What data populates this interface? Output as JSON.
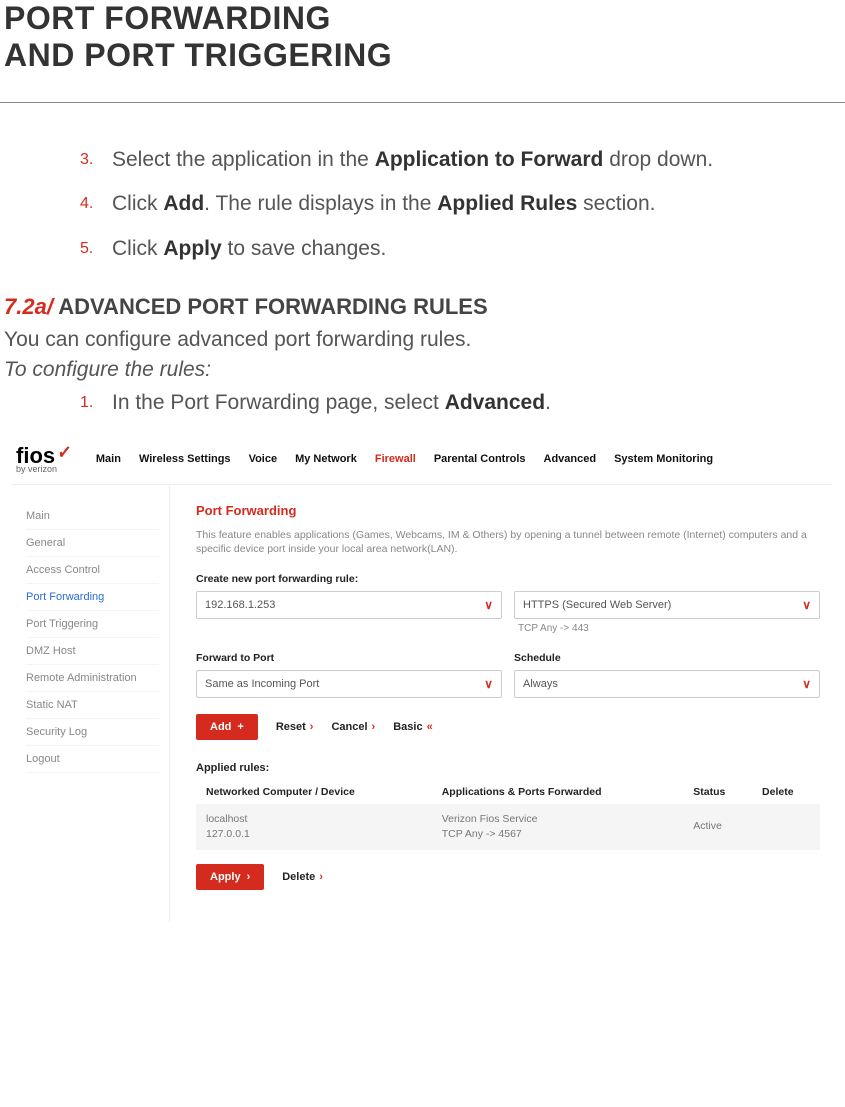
{
  "title_line1": "PORT FORWARDING",
  "title_line2": "AND PORT TRIGGERING",
  "steps_a": [
    {
      "num": "3.",
      "pre": "Select the application in the ",
      "b1": "Application to Forward",
      "post": " drop down."
    },
    {
      "num": "4.",
      "pre": "Click ",
      "b1": "Add",
      "mid": ". The rule displays in the ",
      "b2": "Applied Rules",
      "post": " section."
    },
    {
      "num": "5.",
      "pre": "Click ",
      "b1": "Apply",
      "post": " to save changes."
    }
  ],
  "section": {
    "num": "7.2a/",
    "title": " ADVANCED PORT FORWARDING RULES"
  },
  "intro": "You can configure advanced port forwarding rules.",
  "subintro": "To configure the rules:",
  "steps_b": [
    {
      "num": "1.",
      "pre": "In the Port Forwarding page, select ",
      "b1": "Advanced",
      "post": "."
    }
  ],
  "shot": {
    "logo": {
      "text": "fios",
      "sub": "by verizon"
    },
    "topnav": [
      "Main",
      "Wireless Settings",
      "Voice",
      "My Network",
      "Firewall",
      "Parental Controls",
      "Advanced",
      "System Monitoring"
    ],
    "topnav_active": 4,
    "sidebar": [
      "Main",
      "General",
      "Access Control",
      "Port Forwarding",
      "Port Triggering",
      "DMZ Host",
      "Remote Administration",
      "Static NAT",
      "Security Log",
      "Logout"
    ],
    "sidebar_selected": 3,
    "content": {
      "title": "Port Forwarding",
      "desc": "This feature enables applications (Games, Webcams, IM & Others) by opening a tunnel between remote (Internet) computers and a specific device port inside your local area network(LAN).",
      "create_label": "Create new port forwarding rule:",
      "ip_select": "192.168.1.253",
      "app_select": "HTTPS (Secured Web Server)",
      "app_sub": "TCP Any -> 443",
      "fwd_label": "Forward to Port",
      "fwd_select": "Same as Incoming Port",
      "sch_label": "Schedule",
      "sch_select": "Always",
      "add_btn": "Add",
      "reset_btn": "Reset",
      "cancel_btn": "Cancel",
      "basic_btn": "Basic",
      "applied_label": "Applied rules:",
      "table": {
        "headers": [
          "Networked Computer / Device",
          "Applications & Ports Forwarded",
          "Status",
          "Delete"
        ],
        "row": {
          "dev1": "localhost",
          "dev2": "127.0.0.1",
          "app1": "Verizon Fios Service",
          "app2": "TCP Any -> 4567",
          "status": "Active"
        }
      },
      "apply_btn": "Apply",
      "delete_btn": "Delete"
    }
  }
}
